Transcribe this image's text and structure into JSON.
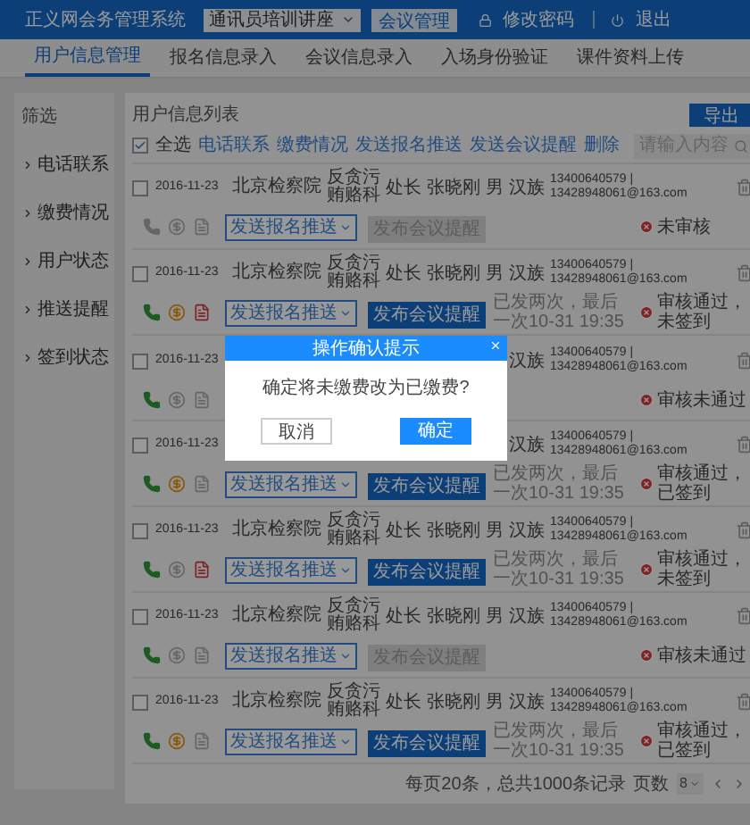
{
  "header": {
    "title": "正义网会务管理系统",
    "meeting_select": "通讯员培训讲座",
    "manage_button": "会议管理",
    "change_password": "修改密码",
    "logout": "退出"
  },
  "tabs": [
    {
      "label": "用户信息管理",
      "selected": true
    },
    {
      "label": "报名信息录入",
      "selected": false
    },
    {
      "label": "会议信息录入",
      "selected": false
    },
    {
      "label": "入场身份验证",
      "selected": false
    },
    {
      "label": "课件资料上传",
      "selected": false
    }
  ],
  "sidebar": {
    "title": "筛选",
    "items": [
      {
        "label": "电话联系"
      },
      {
        "label": "缴费情况"
      },
      {
        "label": "用户状态"
      },
      {
        "label": "推送提醒"
      },
      {
        "label": "签到状态"
      }
    ]
  },
  "panel": {
    "title": "用户信息列表",
    "export_button": "导出",
    "select_all": {
      "label": "全选",
      "checked": true
    },
    "actions": [
      "电话联系",
      "缴费情况",
      "发送报名推送",
      "发送会议提醒",
      "删除"
    ],
    "search": {
      "placeholder": "请输入内容"
    }
  },
  "rows": [
    {
      "checked": false,
      "date": "2016-11-23",
      "org": "北京检察院",
      "dept": "反贪污贿赂科",
      "title": "处长",
      "name": "张晓刚",
      "gender": "男",
      "ethnicity": "汉族",
      "contact": "13400640579 | 13428948061@163.com",
      "called": false,
      "paid": false,
      "reminded": false,
      "push": "发送报名推送",
      "publish": {
        "label": "发布会议提醒",
        "enabled": false
      },
      "status": "未审核"
    },
    {
      "checked": false,
      "date": "2016-11-23",
      "org": "北京检察院",
      "dept": "反贪污贿赂科",
      "title": "处长",
      "name": "张晓刚",
      "gender": "男",
      "ethnicity": "汉族",
      "contact": "13400640579 | 13428948061@163.com",
      "called": true,
      "paid": true,
      "reminded": true,
      "push": "发送报名推送",
      "publish": {
        "label": "发布会议提醒",
        "enabled": true
      },
      "note": "已发两次，最后一次10-31 19:35",
      "status": "审核通过，未签到"
    },
    {
      "checked": false,
      "date": "2016-11-23",
      "ethnicity": "汉族",
      "contact": "13400640579 | 13428948061@163.com",
      "called": true,
      "paid": false,
      "reminded": false,
      "status": "审核未通过"
    },
    {
      "checked": false,
      "date": "2016-11-23",
      "ethnicity": "汉族",
      "contact": "13400640579 | 13428948061@163.com",
      "called": true,
      "paid": true,
      "reminded": false,
      "push": "发送报名推送",
      "publish": {
        "label": "发布会议提醒",
        "enabled": true
      },
      "note": "已发两次，最后一次10-31 19:35",
      "status": "审核通过，已签到"
    },
    {
      "checked": false,
      "date": "2016-11-23",
      "org": "北京检察院",
      "dept": "反贪污贿赂科",
      "title": "处长",
      "name": "张晓刚",
      "gender": "男",
      "ethnicity": "汉族",
      "contact": "13400640579 | 13428948061@163.com",
      "called": true,
      "paid": false,
      "reminded": true,
      "push": "发送报名推送",
      "publish": {
        "label": "发布会议提醒",
        "enabled": true
      },
      "note": "已发两次，最后一次10-31 19:35",
      "status": "审核通过，未签到"
    },
    {
      "checked": false,
      "date": "2016-11-23",
      "org": "北京检察院",
      "dept": "反贪污贿赂科",
      "title": "处长",
      "name": "张晓刚",
      "gender": "男",
      "ethnicity": "汉族",
      "contact": "13400640579 | 13428948061@163.com",
      "called": true,
      "paid": false,
      "reminded": false,
      "push": "发送报名推送",
      "publish": {
        "label": "发布会议提醒",
        "enabled": false
      },
      "status": "审核未通过"
    },
    {
      "checked": false,
      "date": "2016-11-23",
      "org": "北京检察院",
      "dept": "反贪污贿赂科",
      "title": "处长",
      "name": "张晓刚",
      "gender": "男",
      "ethnicity": "汉族",
      "contact": "13400640579 | 13428948061@163.com",
      "called": true,
      "paid": true,
      "reminded": false,
      "push": "发送报名推送",
      "publish": {
        "label": "发布会议提醒",
        "enabled": true
      },
      "note": "已发两次，最后一次10-31 19:35",
      "status": "审核通过，已签到"
    }
  ],
  "footer": {
    "summary": "每页20条，总共1000条记录",
    "pages_label": "页数",
    "page": "8"
  },
  "dialog": {
    "title": "操作确认提示",
    "message": "确定将未缴费改为已缴费?",
    "cancel": "取消",
    "confirm": "确定"
  }
}
